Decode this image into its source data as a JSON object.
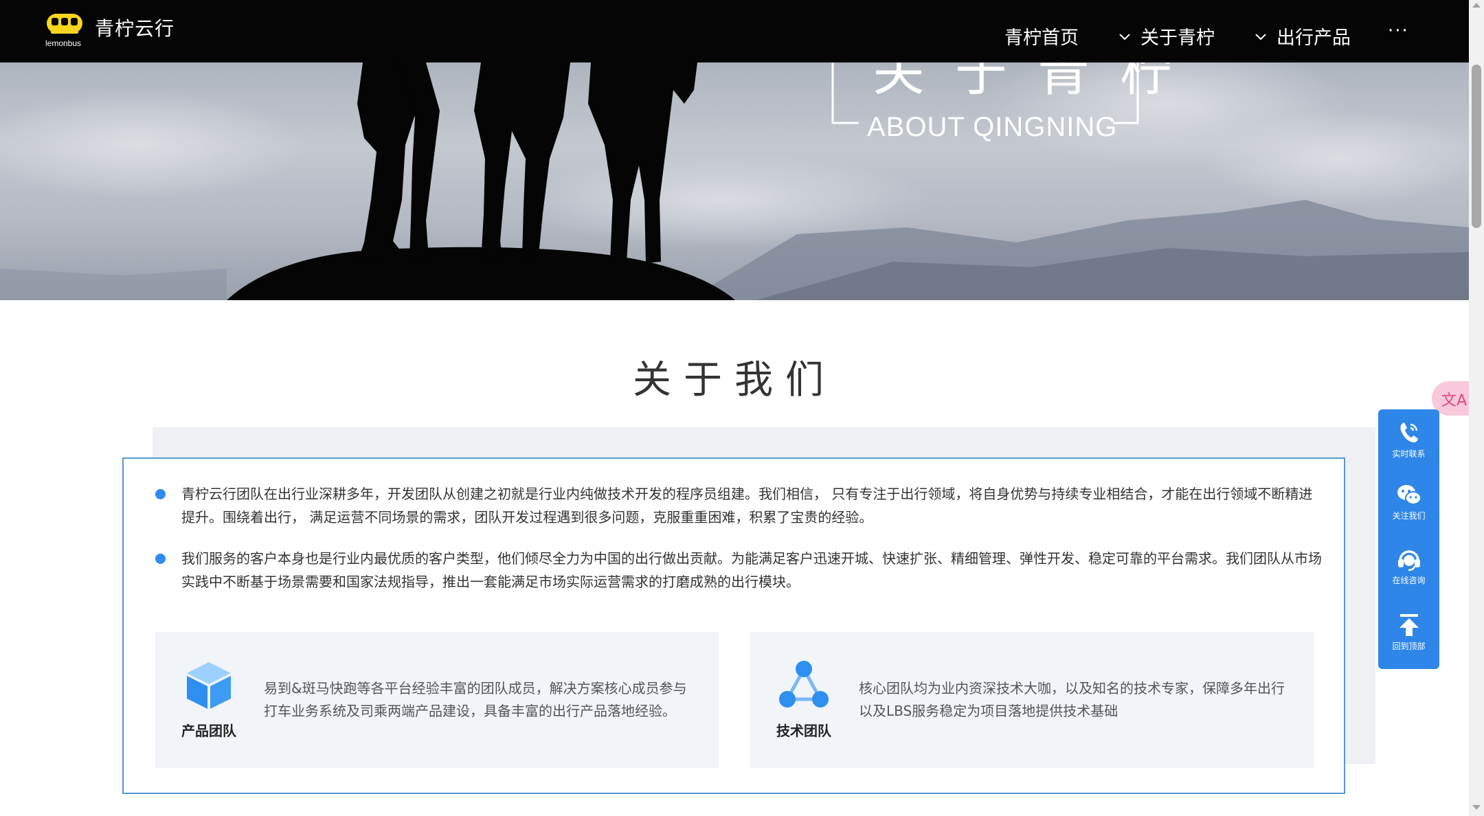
{
  "nav": {
    "brand": "青柠云行",
    "logo_sub": "lemonbus",
    "items": [
      {
        "label": "青柠首页"
      },
      {
        "label": "关于青柠"
      },
      {
        "label": "出行产品"
      },
      {
        "label": "···"
      }
    ]
  },
  "hero": {
    "title_cn": "关于青柠",
    "title_en": "ABOUT QINGNING"
  },
  "about": {
    "heading": "关于我们",
    "paragraphs": [
      "青柠云行团队在出行业深耕多年，开发团队从创建之初就是行业内纯做技术开发的程序员组建。我们相信， 只有专注于出行领域，将自身优势与持续专业相结合，才能在出行领域不断精进提升。围绕着出行， 满足运营不同场景的需求，团队开发过程遇到很多问题，克服重重困难，积累了宝贵的经验。",
      "我们服务的客户本身也是行业内最优质的客户类型，他们倾尽全力为中国的出行做出贡献。为能满足客户迅速开城、快速扩张、精细管理、弹性开发、稳定可靠的平台需求。我们团队从市场 实践中不断基于场景需要和国家法规指导，推出一套能满足市场实际运营需求的打磨成熟的出行模块。"
    ],
    "cards": [
      {
        "label": "产品团队",
        "text": "易到&斑马快跑等各平台经验丰富的团队成员，解决方案核心成员参与打车业务系统及司乘两端产品建设，具备丰富的出行产品落地经验。",
        "icon": "cube-icon"
      },
      {
        "label": "技术团队",
        "text": "核心团队均为业内资深技术大咖，以及知名的技术专家，保障多年出行以及LBS服务稳定为项目落地提供技术基础",
        "icon": "network-icon"
      }
    ]
  },
  "side_panel": {
    "items": [
      {
        "label": "实时联系",
        "icon": "phone-icon"
      },
      {
        "label": "关注我们",
        "icon": "wechat-icon"
      },
      {
        "label": "在线咨询",
        "icon": "headset-icon"
      },
      {
        "label": "回到顶部",
        "icon": "arrow-up-icon"
      }
    ]
  },
  "translate": {
    "label": "文A"
  },
  "colors": {
    "accent": "#2e86e8",
    "nav_bg": "#050505",
    "border": "#5a97d1",
    "logo": "#f7d51d"
  }
}
